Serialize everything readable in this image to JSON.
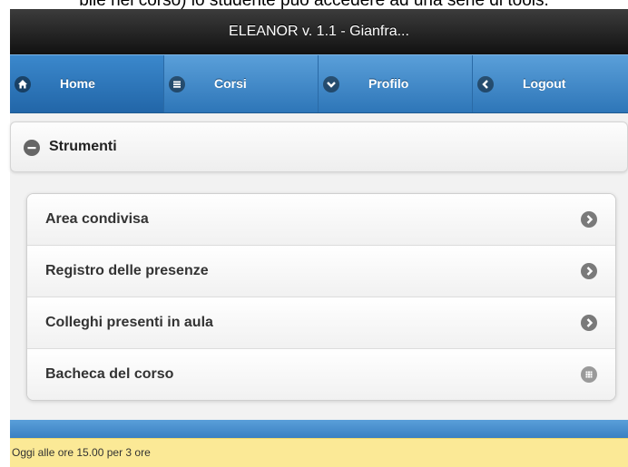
{
  "document": {
    "caption": "bile nel corso) lo studente può accedere ad una serie di tools."
  },
  "header": {
    "title": "ELEANOR v. 1.1 - Gianfra..."
  },
  "navbar": {
    "items": [
      {
        "label": "Home",
        "icon": "home-icon"
      },
      {
        "label": "Corsi",
        "icon": "bars-icon"
      },
      {
        "label": "Profilo",
        "icon": "chevron-down-icon"
      },
      {
        "label": "Logout",
        "icon": "chevron-left-icon"
      }
    ],
    "active_index": 0
  },
  "tools": {
    "title": "Strumenti",
    "items": [
      {
        "label": "Area condivisa",
        "icon": "arrow-right-icon"
      },
      {
        "label": "Registro delle presenze",
        "icon": "arrow-right-icon"
      },
      {
        "label": "Colleghi presenti in aula",
        "icon": "arrow-right-icon"
      },
      {
        "label": "Bacheca del corso",
        "icon": "grid-icon"
      }
    ]
  },
  "footer": {
    "notice": "Oggi alle ore 15.00 per 3 ore"
  },
  "colors": {
    "titlebar": "#222222",
    "navbar": "#3d88cc",
    "notice_bg": "#fbe996"
  }
}
